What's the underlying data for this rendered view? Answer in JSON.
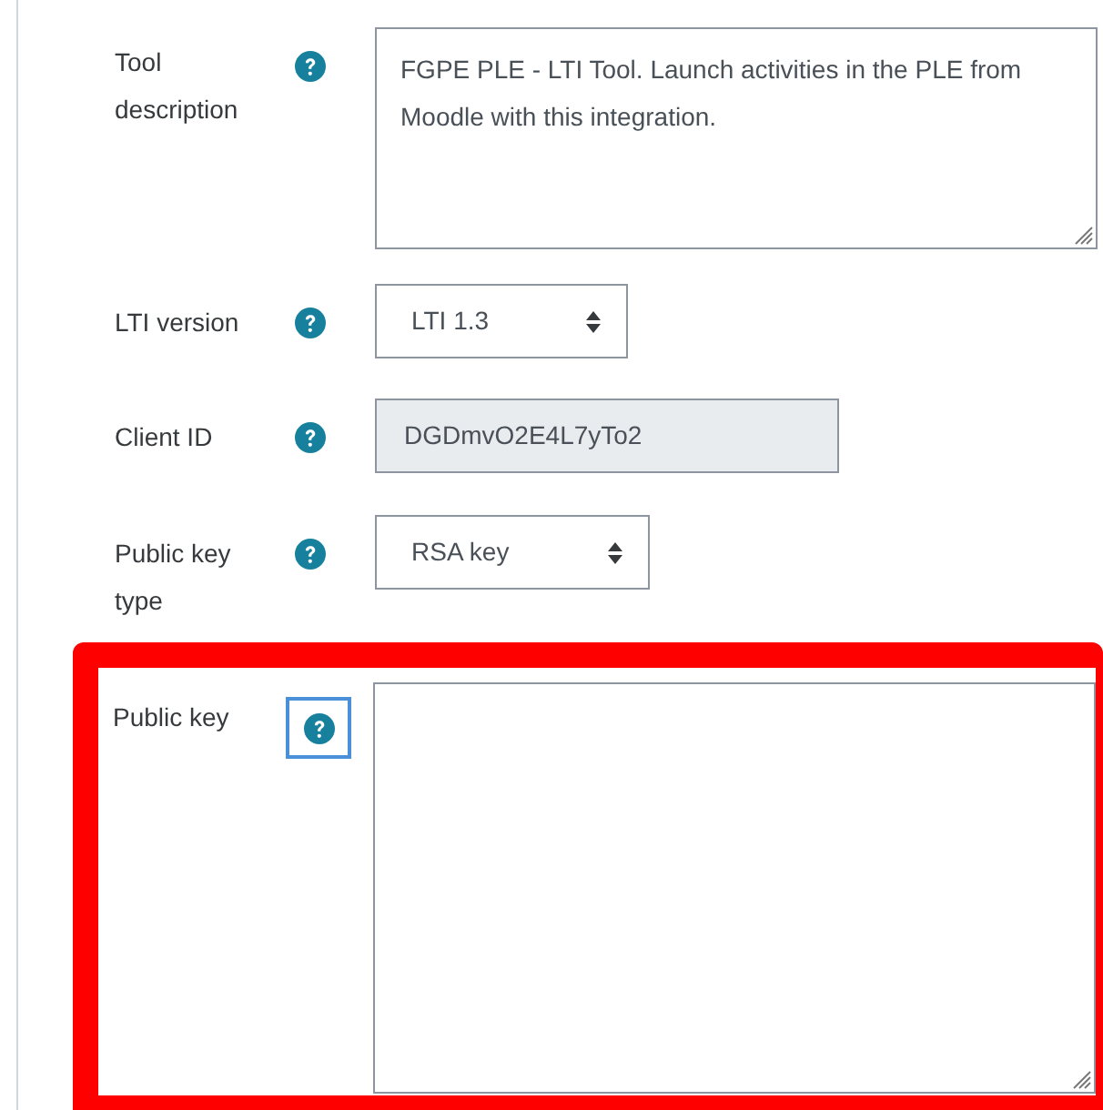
{
  "fields": [
    {
      "kind": "textarea",
      "label": "Tool description",
      "value": "FGPE PLE - LTI Tool. Launch activities in the PLE from Moodle with this integration.",
      "help_focused": false,
      "highlighted": false
    },
    {
      "kind": "select",
      "label": "LTI version",
      "value": "LTI 1.3",
      "help_focused": false,
      "highlighted": false
    },
    {
      "kind": "readonly",
      "label": "Client ID",
      "value": "DGDmvO2E4L7yTo2",
      "help_focused": false,
      "highlighted": false
    },
    {
      "kind": "select",
      "label": "Public key type",
      "value": "RSA key",
      "help_focused": false,
      "highlighted": false
    },
    {
      "kind": "textarea",
      "label": "Public key",
      "help_focused": true,
      "highlighted": true
    }
  ]
}
